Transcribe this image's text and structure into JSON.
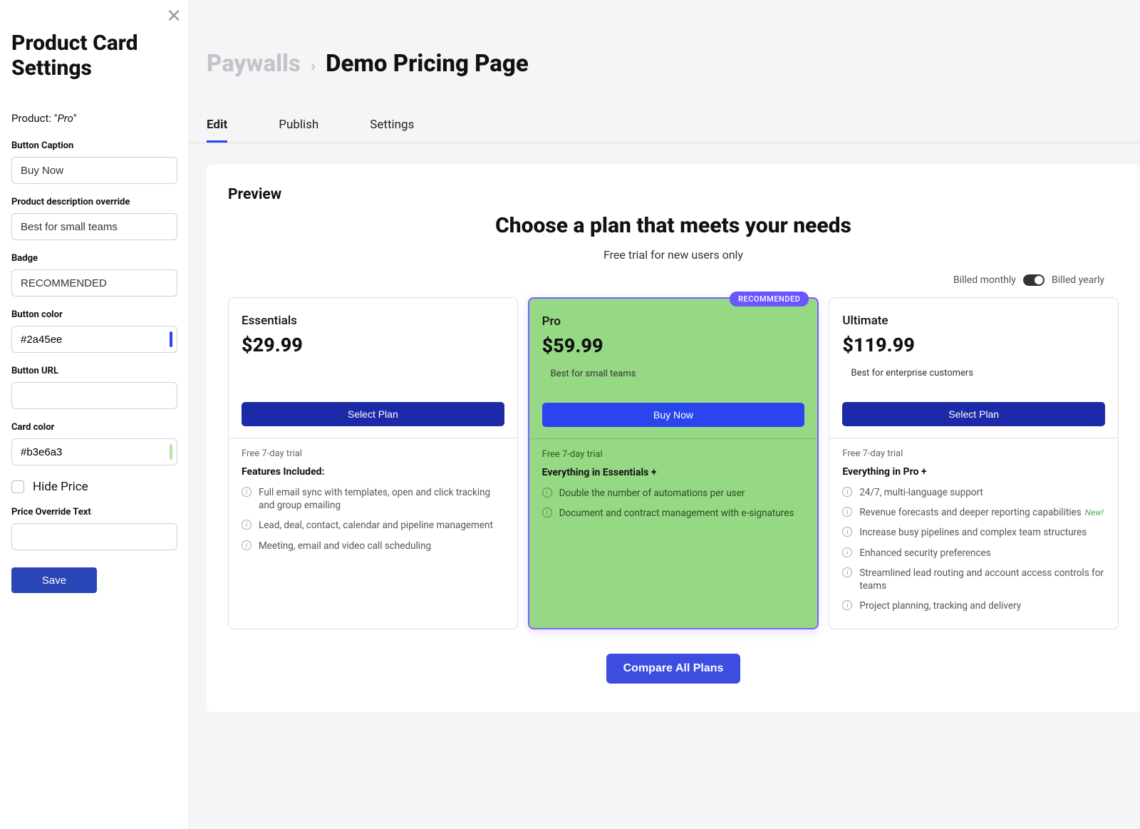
{
  "sidebar": {
    "title": "Product Card Settings",
    "product_prefix": "Product: \"",
    "product_name": "Pro",
    "product_suffix": "\"",
    "fields": {
      "button_caption": {
        "label": "Button Caption",
        "value": "Buy Now"
      },
      "desc_override": {
        "label": "Product description override",
        "value": "Best for small teams"
      },
      "badge": {
        "label": "Badge",
        "value": "RECOMMENDED"
      },
      "button_color": {
        "label": "Button color",
        "value": "#2a45ee"
      },
      "button_url": {
        "label": "Button URL",
        "value": ""
      },
      "card_color": {
        "label": "Card color",
        "value": "#b3e6a3"
      },
      "hide_price": {
        "label": "Hide Price",
        "checked": false
      },
      "price_override": {
        "label": "Price Override Text",
        "value": ""
      }
    },
    "save_label": "Save"
  },
  "breadcrumb": {
    "root": "Paywalls",
    "current": "Demo Pricing Page"
  },
  "tabs": [
    "Edit",
    "Publish",
    "Settings"
  ],
  "active_tab": 0,
  "preview": {
    "label": "Preview",
    "heading": "Choose a plan that meets your needs",
    "subheading": "Free trial for new users only",
    "billing": {
      "monthly": "Billed monthly",
      "yearly": "Billed yearly"
    },
    "compare": "Compare All Plans"
  },
  "colors": {
    "select_plan_btn": "#1c2aa8",
    "buy_now_btn": "#2a45ee",
    "highlight_card": "#96d985"
  },
  "plans": [
    {
      "name": "Essentials",
      "price": "$29.99",
      "desc": "",
      "button": "Select Plan",
      "trial": "Free 7-day trial",
      "features_title": "Features Included:",
      "features": [
        {
          "text": "Full email sync with templates, open and click tracking and group emailing"
        },
        {
          "text": "Lead, deal, contact, calendar and pipeline management"
        },
        {
          "text": "Meeting, email and video call scheduling"
        }
      ],
      "highlight": false
    },
    {
      "name": "Pro",
      "price": "$59.99",
      "desc": "Best for small teams",
      "badge": "RECOMMENDED",
      "button": "Buy Now",
      "trial": "Free 7-day trial",
      "features_title": "Everything in Essentials +",
      "features": [
        {
          "text": "Double the number of automations per user"
        },
        {
          "text": "Document and contract management with e-signatures"
        }
      ],
      "highlight": true
    },
    {
      "name": "Ultimate",
      "price": "$119.99",
      "desc": "Best for enterprise customers",
      "button": "Select Plan",
      "trial": "Free 7-day trial",
      "features_title": "Everything in Pro +",
      "features": [
        {
          "text": "24/7, multi-language support"
        },
        {
          "text": "Revenue forecasts and deeper reporting capabilities",
          "new": "New!"
        },
        {
          "text": "Increase busy pipelines and complex team structures"
        },
        {
          "text": "Enhanced security preferences"
        },
        {
          "text": "Streamlined lead routing and account access controls for teams"
        },
        {
          "text": "Project planning, tracking and delivery"
        }
      ],
      "highlight": false
    }
  ]
}
